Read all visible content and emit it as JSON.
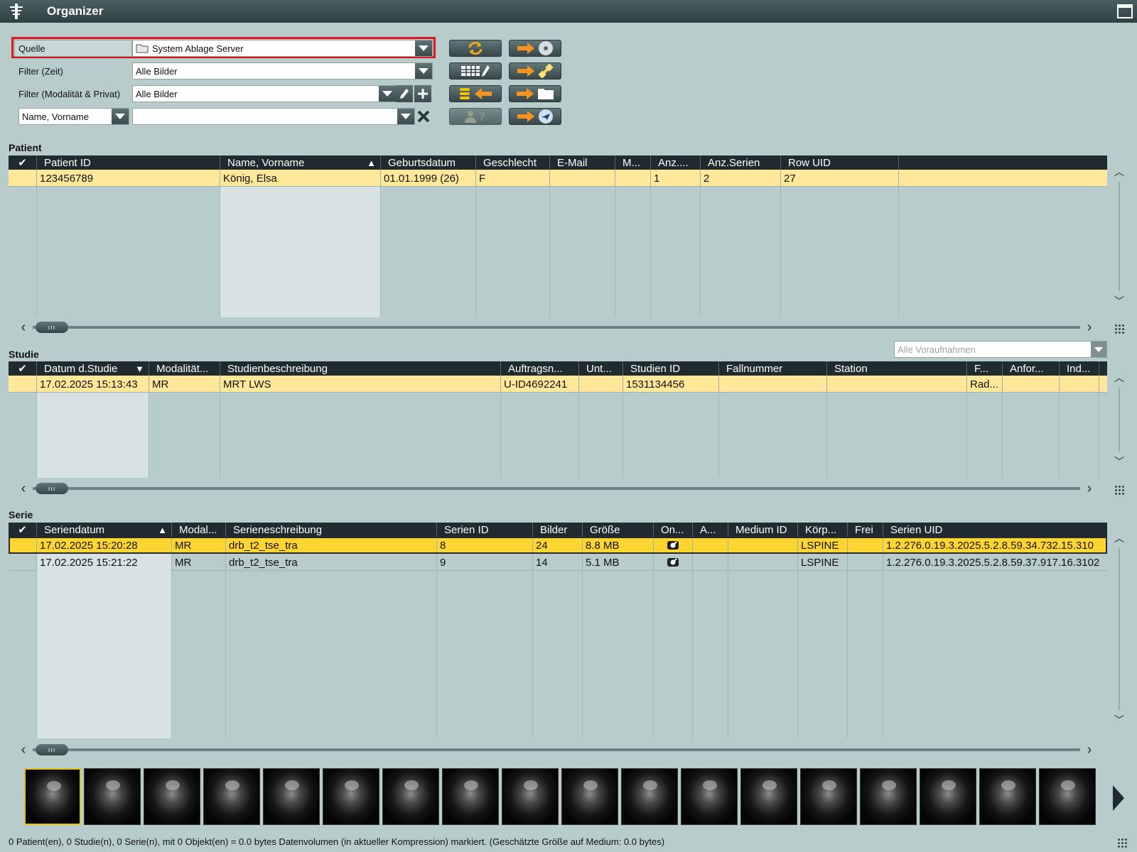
{
  "window": {
    "title": "Organizer"
  },
  "filters": {
    "source_label": "Quelle",
    "source_value": "System Ablage Server",
    "time_label": "Filter (Zeit)",
    "time_value": "Alle Bilder",
    "modality_label": "Filter (Modalität & Privat)",
    "modality_value": "Alle Bilder",
    "search_field_type": "Name, Vorname",
    "search_value": ""
  },
  "patient": {
    "title": "Patient",
    "columns": [
      "Patient ID",
      "Name, Vorname",
      "Geburtsdatum",
      "Geschlecht",
      "E-Mail",
      "M...",
      "Anz....",
      "Anz.Serien",
      "Row UID"
    ],
    "rows": [
      [
        "123456789",
        "König, Elsa",
        "01.01.1999 (26)",
        "F",
        "",
        "",
        "1",
        "2",
        "27"
      ]
    ]
  },
  "study": {
    "title": "Studie",
    "prior_filter_placeholder": "Alle Voraufnahmen",
    "columns": [
      "Datum d.Studie",
      "Modalität...",
      "Studienbeschreibung",
      "Auftragsn...",
      "Unt...",
      "Studien ID",
      "Fallnummer",
      "Station",
      "F...",
      "Anfor...",
      "Ind..."
    ],
    "rows": [
      [
        "17.02.2025 15:13:43",
        "MR",
        "MRT LWS",
        "U-ID4692241",
        "",
        "1531134456",
        "",
        "",
        "Rad...",
        "",
        ""
      ]
    ]
  },
  "series": {
    "title": "Serie",
    "columns": [
      "Seriendatum",
      "Modal...",
      "Serieneschreibung",
      "Serien ID",
      "Bilder",
      "Größe",
      "On...",
      "A...",
      "Medium ID",
      "Körp...",
      "Frei",
      "Serien UID"
    ],
    "rows": [
      [
        "17.02.2025 15:20:28",
        "MR",
        "drb_t2_tse_tra",
        "8",
        "24",
        "8.8 MB",
        "",
        "",
        "",
        "LSPINE",
        "",
        "1.2.276.0.19.3.2025.5.2.8.59.34.732.15.310"
      ],
      [
        "17.02.2025 15:21:22",
        "MR",
        "drb_t2_tse_tra",
        "9",
        "14",
        "5.1 MB",
        "",
        "",
        "",
        "LSPINE",
        "",
        "1.2.276.0.19.3.2025.5.2.8.59.37.917.16.3102"
      ]
    ]
  },
  "status": {
    "text": "0 Patient(en), 0 Studie(n), 0 Serie(n), mit 0 Objekt(en) = 0.0 bytes Datenvolumen (in aktueller Kompression) markiert. (Geschätzte Größe auf Medium: 0.0 bytes)"
  },
  "colors": {
    "selected_row": "#ffe89a",
    "active_row": "#ffd631",
    "highlight_frame": "#e0161e",
    "header_bg": "#1f2b2e"
  },
  "icons": {
    "refresh": "refresh-icon",
    "cd": "cd-icon",
    "table_edit": "table-edit-icon",
    "satellite": "satellite-icon",
    "import_db": "database-import-icon",
    "folder_export": "folder-export-icon",
    "user_query": "user-query-icon",
    "send": "send-icon"
  }
}
